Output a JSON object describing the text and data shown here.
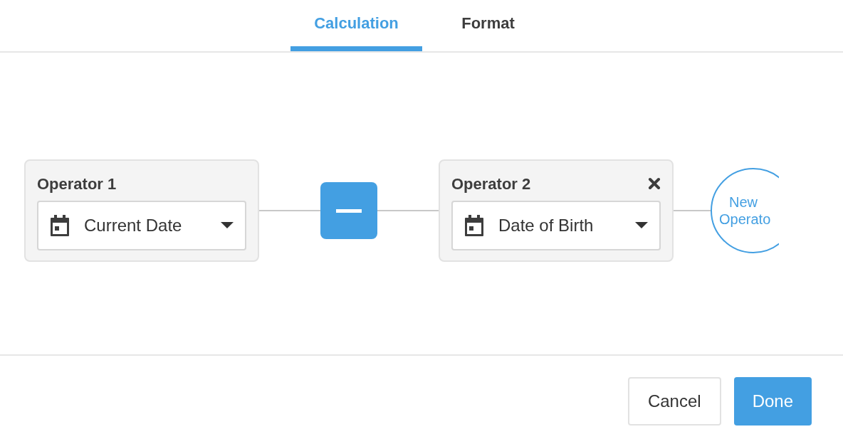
{
  "tabs": [
    {
      "label": "Calculation",
      "selected": true
    },
    {
      "label": "Format",
      "selected": false
    }
  ],
  "operands": [
    {
      "title": "Operator 1",
      "value": "Current Date",
      "removable": false
    },
    {
      "title": "Operator 2",
      "value": "Date of Birth",
      "removable": true
    }
  ],
  "operator": {
    "kind": "minus"
  },
  "new_operator": {
    "lines": [
      "New",
      "Operato"
    ]
  },
  "buttons": [
    {
      "label": "Cancel",
      "kind": "secondary"
    },
    {
      "label": "Done",
      "kind": "primary"
    }
  ]
}
